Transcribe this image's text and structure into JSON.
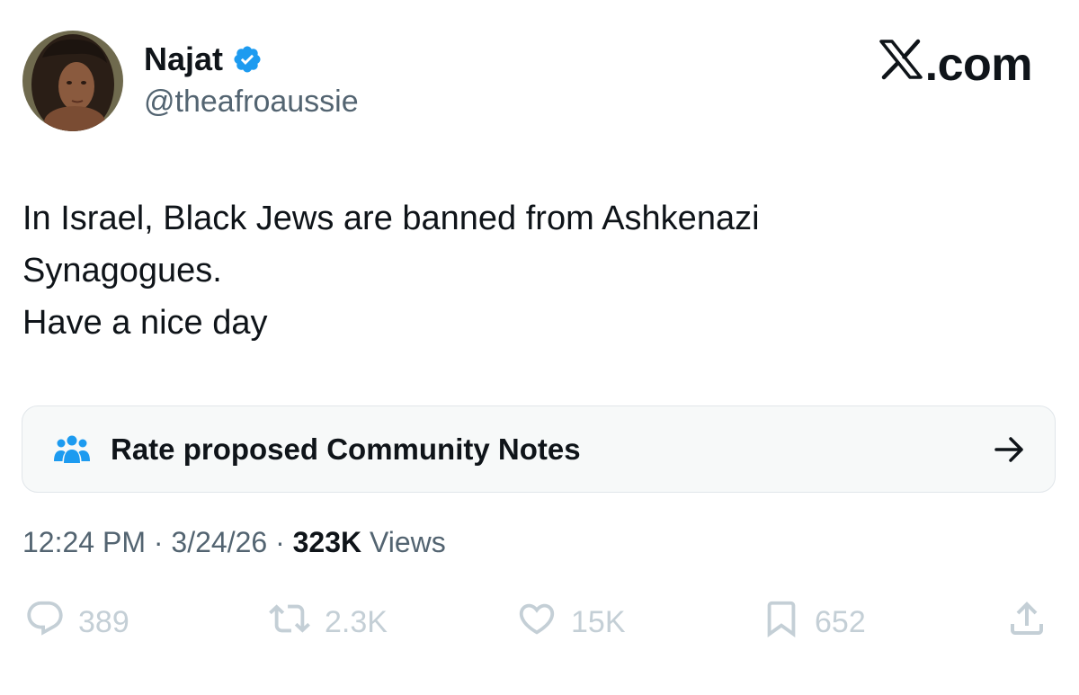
{
  "author": {
    "display_name": "Najat",
    "handle": "@theafroaussie",
    "verified": true
  },
  "site_logo": {
    "letter": "X",
    "suffix": ".com"
  },
  "tweet": {
    "lines": [
      "In Israel, Black Jews are banned from Ashkenazi",
      "Synagogues.",
      "Have a nice day"
    ]
  },
  "community_notes": {
    "label": "Rate proposed Community Notes",
    "icon": "people-group-icon"
  },
  "meta": {
    "time": "12:24 PM",
    "sep1": " · ",
    "date": "3/24/26",
    "sep2": " · ",
    "views_count": "323K",
    "views_label": " Views"
  },
  "actions": {
    "reply_count": "389",
    "repost_count": "2.3K",
    "like_count": "15K",
    "bookmark_count": "652"
  },
  "colors": {
    "text": "#0f1419",
    "secondary": "#536471",
    "verified_blue": "#1d9bf0",
    "action_gray": "#c4cfd6",
    "banner_bg": "#f7f9f9",
    "notes_icon_blue": "#1d9bf0"
  }
}
